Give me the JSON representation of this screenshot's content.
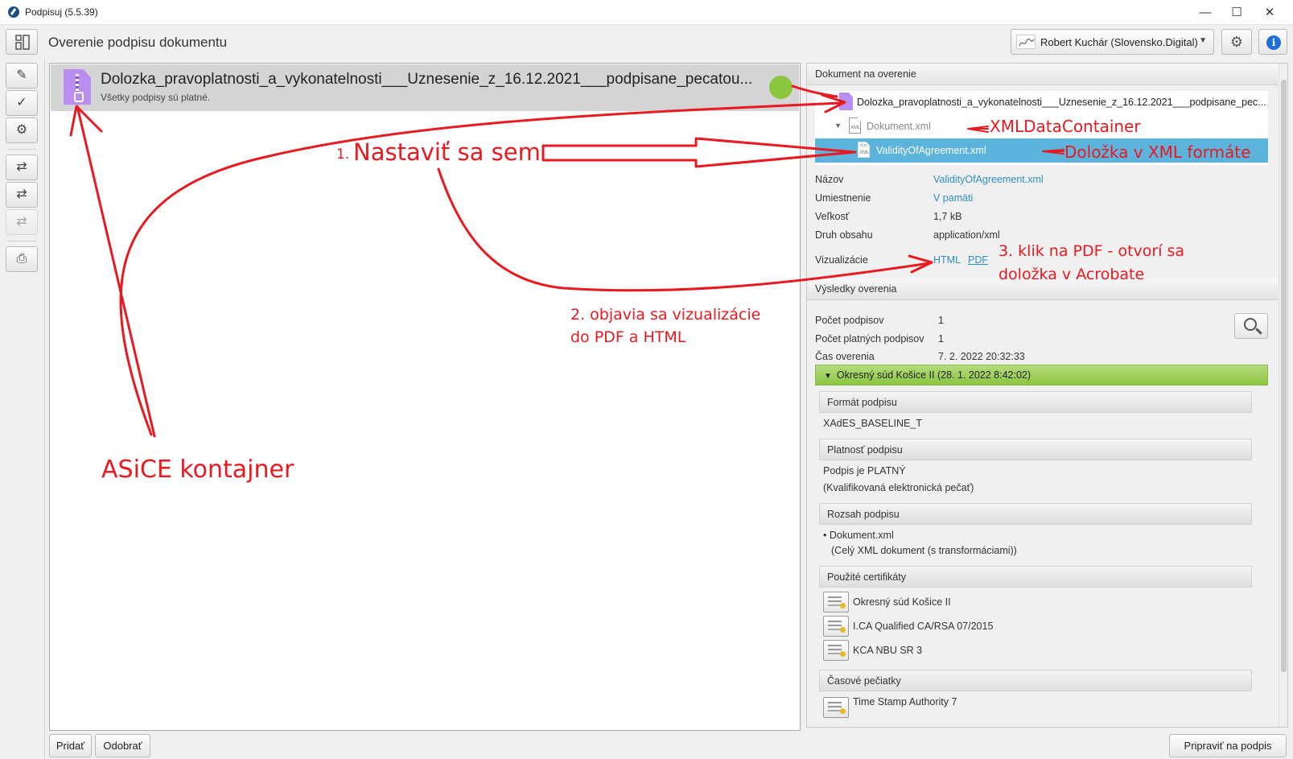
{
  "window": {
    "title": "Podpisuj (5.5.39)",
    "controls": {
      "minimize": "—",
      "maximize": "☐",
      "close": "✕"
    }
  },
  "header": {
    "page_title": "Overenie podpisu dokumentu",
    "user_name": "Robert Kuchár (Slovensko.Digital)",
    "settings_icon": "gear-icon",
    "info_icon": "info-icon",
    "info_glyph": "i"
  },
  "toolbar": {
    "items": [
      {
        "name": "sign-pen-icon",
        "glyph": "✎"
      },
      {
        "name": "verify-check-icon",
        "glyph": "✓"
      },
      {
        "name": "settings-gear-icon",
        "glyph": "⚙"
      },
      {
        "name": "convert-pdf-icon",
        "glyph": "⇄"
      },
      {
        "name": "convert-e-icon",
        "glyph": "⇄"
      },
      {
        "name": "convert-disabled-icon",
        "glyph": "⇄"
      },
      {
        "name": "print-icon",
        "glyph": "⎙"
      }
    ]
  },
  "documents": [
    {
      "name": "Dolozka_pravoplatnosti_a_vykonatelnosti___Uznesenie_z_16.12.2021___podpisane_pecatou...",
      "status": "Všetky podpisy sú platné.",
      "valid_color": "#8cc63f"
    }
  ],
  "buttons": {
    "add": "Pridať",
    "remove": "Odobrať",
    "prepare": "Pripraviť na podpis"
  },
  "panel": {
    "doc_section_title": "Dokument na overenie",
    "tree": {
      "root": "Dolozka_pravoplatnosti_a_vykonatelnosti___Uznesenie_z_16.12.2021___podpisane_pec...",
      "child": "Dokument.xml",
      "child_icon_label": "XML",
      "selected": "ValidityOfAgreement.xml",
      "selected_icon_glyph": "<>",
      "selected_icon_label": "XML"
    },
    "properties": {
      "name_label": "Názov",
      "name_value": "ValidityOfAgreement.xml",
      "location_label": "Umiestnenie",
      "location_value": "V pamäti",
      "size_label": "Veľkosť",
      "size_value": "1,7 kB",
      "type_label": "Druh obsahu",
      "type_value": "application/xml",
      "vis_label": "Vizualizácie",
      "vis_html": "HTML",
      "vis_pdf": "PDF"
    },
    "results_section_title": "Výsledky overenia",
    "results": {
      "count_label": "Počet podpisov",
      "count_value": "1",
      "valid_count_label": "Počet platných podpisov",
      "valid_count_value": "1",
      "time_label": "Čas overenia",
      "time_value": "7. 2. 2022 20:32:33"
    },
    "signer": {
      "title": "Okresný súd Košice II (28. 1. 2022 8:42:02)",
      "color": "#8cc63f"
    },
    "format": {
      "title": "Formát podpisu",
      "value": "XAdES_BASELINE_T"
    },
    "validity": {
      "title": "Platnosť podpisu",
      "line1": "Podpis je PLATNÝ",
      "line2": "(Kvalifikovaná elektronická pečať)"
    },
    "scope": {
      "title": "Rozsah podpisu",
      "item": "Dokument.xml",
      "item_note": "(Celý XML dokument (s transformáciami))"
    },
    "certs": {
      "title": "Použité certifikáty",
      "items": [
        "Okresný súd Košice II",
        "I.CA Qualified CA/RSA 07/2015",
        "KCA NBU SR 3"
      ]
    },
    "timestamps": {
      "title": "Časové pečiatky",
      "item": "Time Stamp Authority 7"
    }
  },
  "annotations": {
    "step1_num": "1.",
    "step1": "Nastaviť sa sem",
    "xml_container": "XMLDataContainer",
    "xml_clause": "Doložka v XML formáte",
    "step2_line1": "2. objavia sa vizualizácie",
    "step2_line2": "do PDF a HTML",
    "step3_line1": "3. klik na PDF - otvorí sa",
    "step3_line2": "doložka v Acrobate",
    "asice": "ASiCE kontajner",
    "color": "#e8191f"
  }
}
